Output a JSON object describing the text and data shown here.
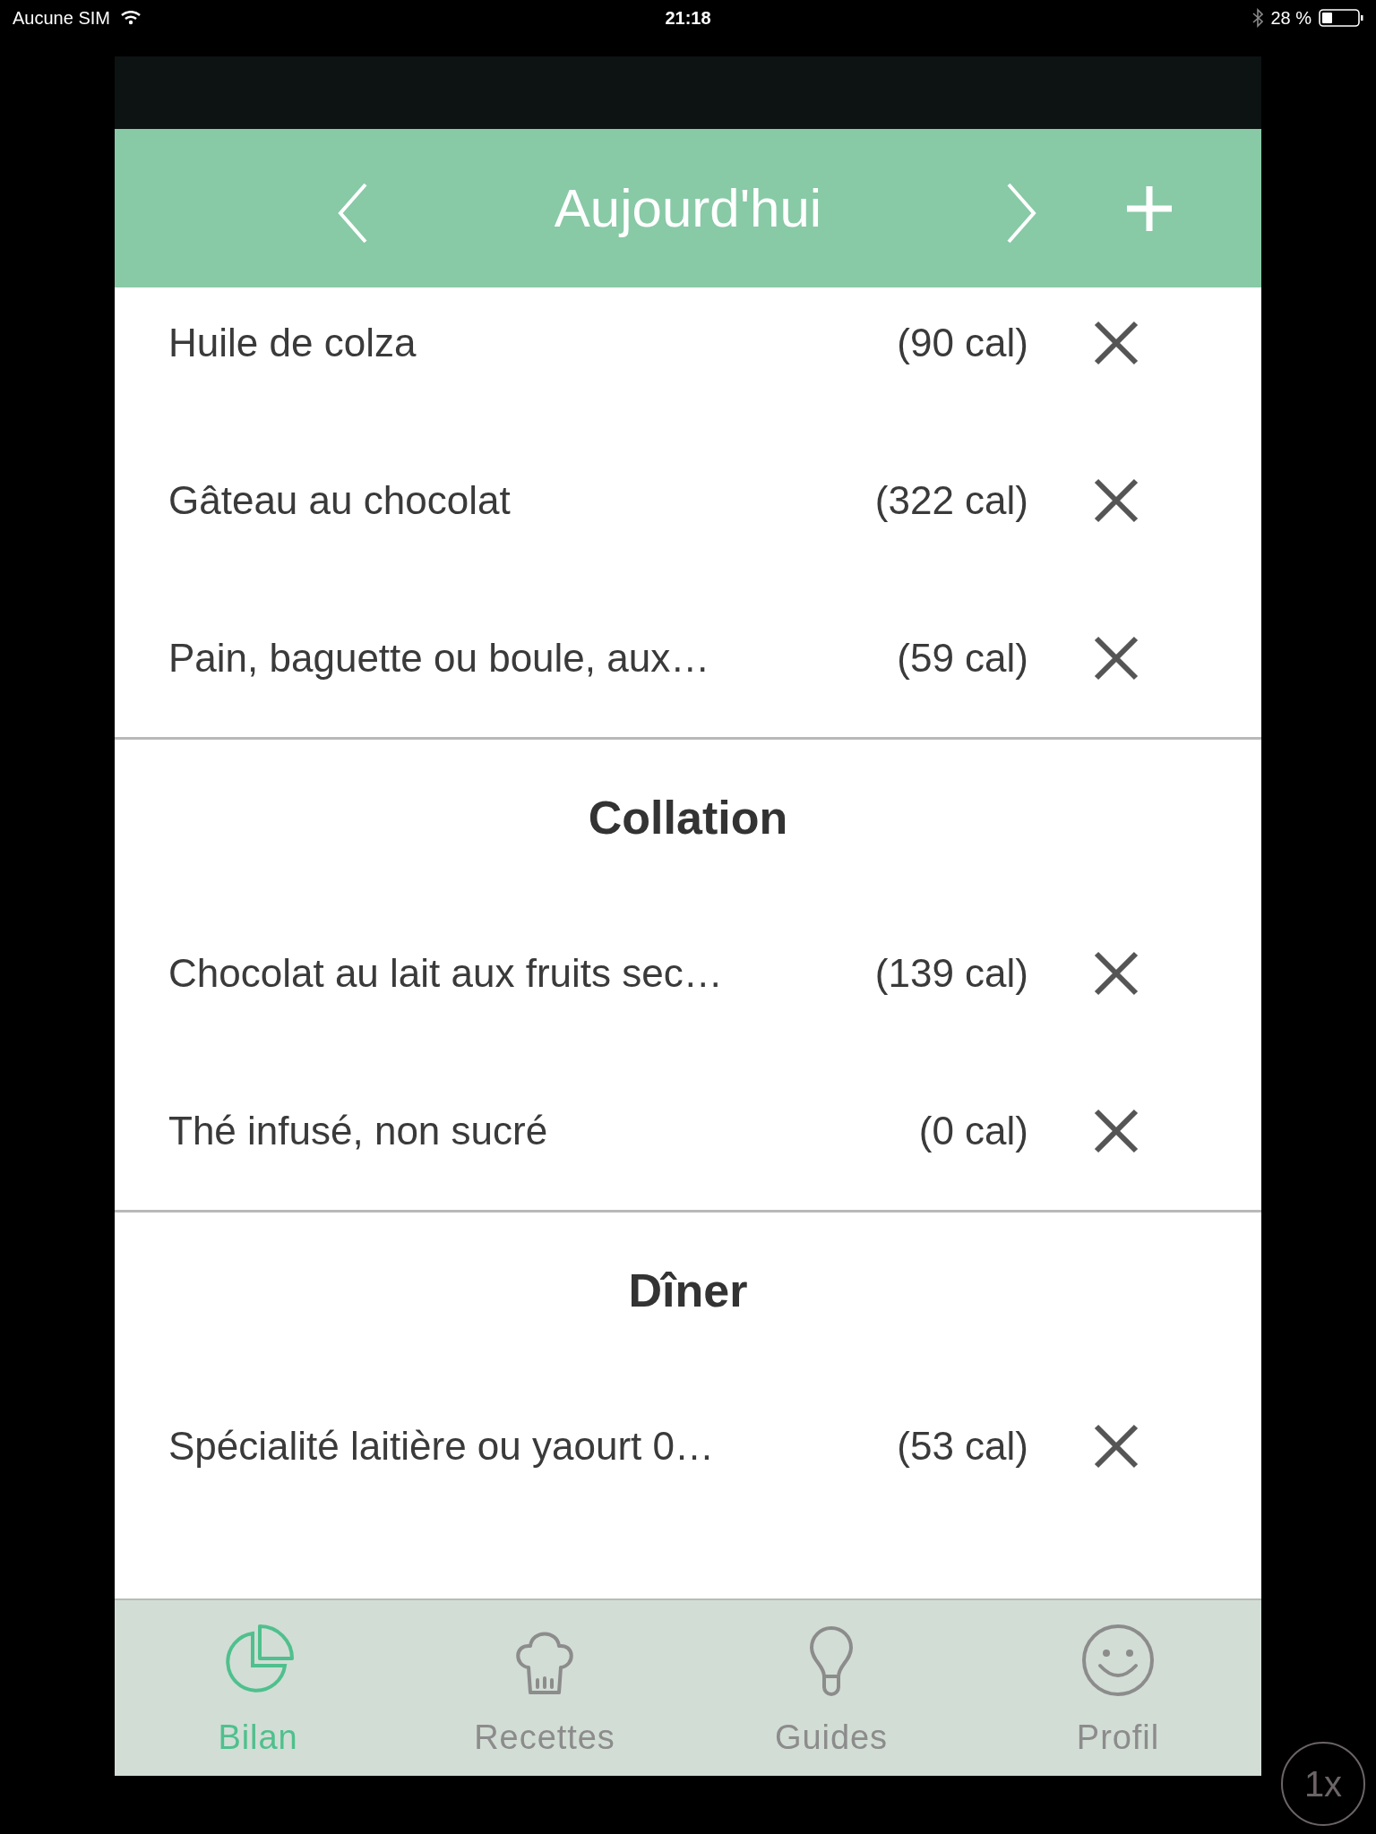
{
  "status_bar": {
    "carrier": "Aucune SIM",
    "time": "21:18",
    "battery": "28 %"
  },
  "header": {
    "title": "Aujourd'hui"
  },
  "list": [
    {
      "kind": "item",
      "name": "Huile de colza",
      "calories": "(90 cal)"
    },
    {
      "kind": "item",
      "name": "Gâteau au chocolat",
      "calories": "(322 cal)"
    },
    {
      "kind": "item",
      "name": "Pain, baguette ou boule, aux…",
      "calories": "(59 cal)"
    },
    {
      "kind": "section",
      "title": "Collation"
    },
    {
      "kind": "item",
      "name": "Chocolat au lait aux fruits sec…",
      "calories": "(139 cal)"
    },
    {
      "kind": "item",
      "name": "Thé infusé, non sucré",
      "calories": "(0 cal)"
    },
    {
      "kind": "section",
      "title": "Dîner"
    },
    {
      "kind": "item",
      "name": "Spécialité laitière ou yaourt 0…",
      "calories": "(53 cal)"
    }
  ],
  "tab_bar": [
    {
      "label": "Bilan",
      "selected": true
    },
    {
      "label": "Recettes",
      "selected": false
    },
    {
      "label": "Guides",
      "selected": false
    },
    {
      "label": "Profil",
      "selected": false
    }
  ],
  "zoom_button": {
    "label": "1x"
  }
}
